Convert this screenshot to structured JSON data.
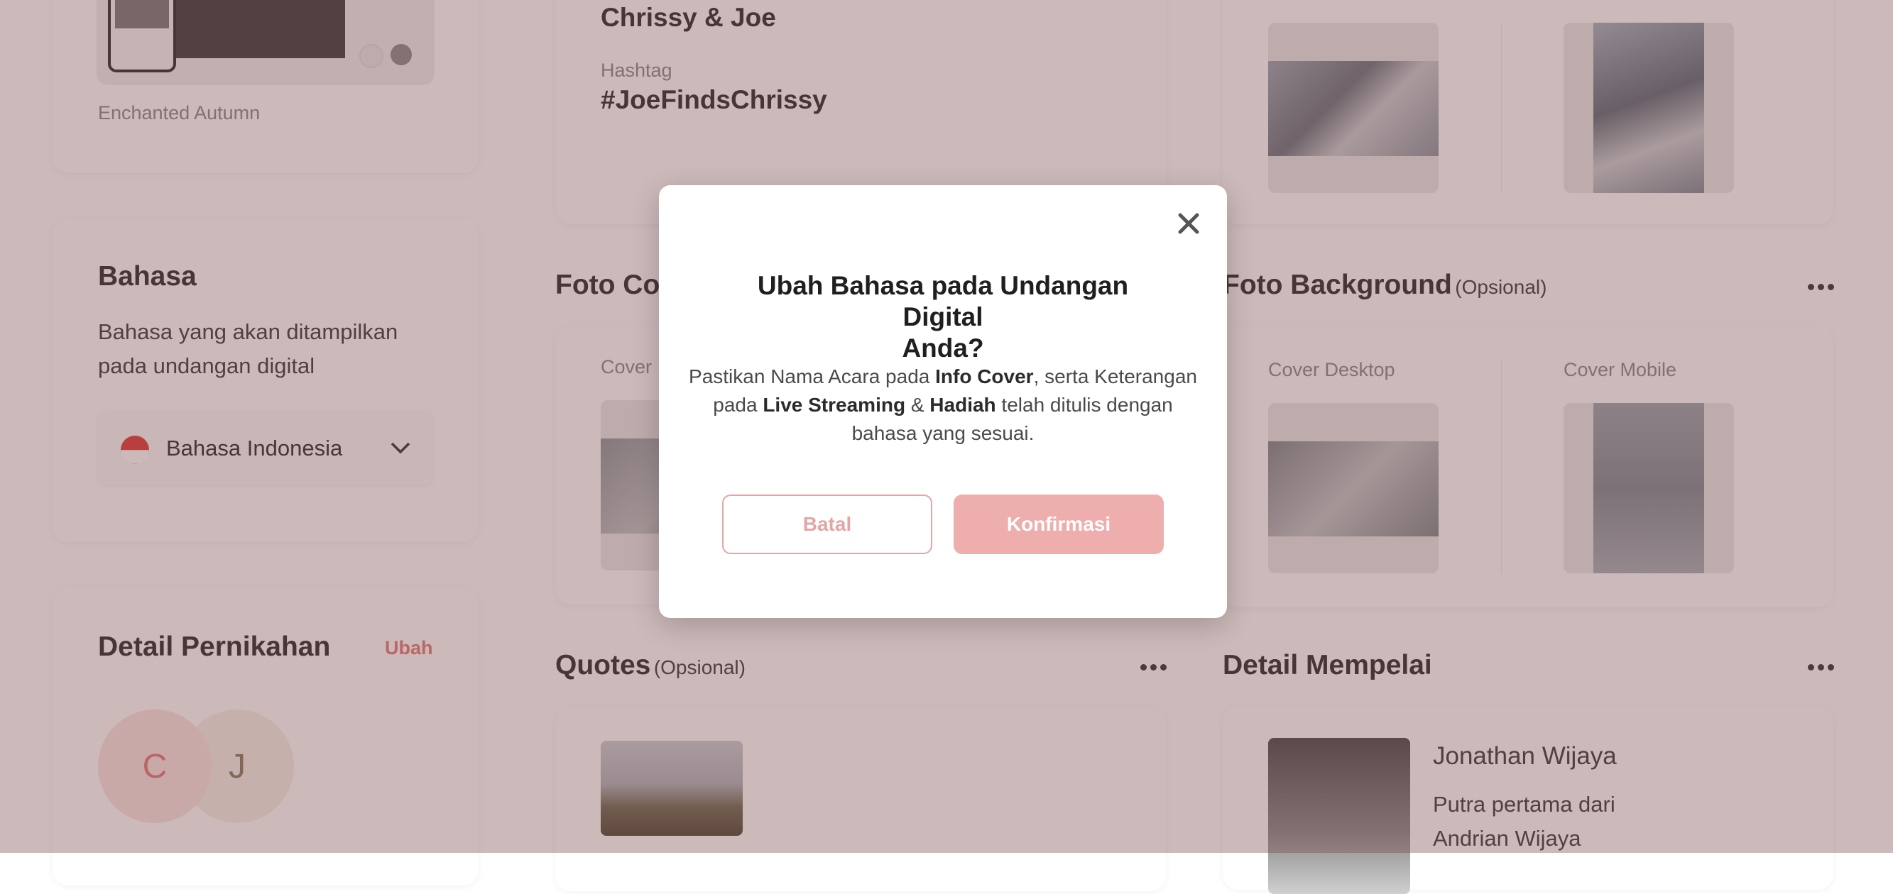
{
  "theme_card": {
    "theme_name": "Enchanted Autumn"
  },
  "language_card": {
    "title": "Bahasa",
    "description_line1": "Bahasa yang akan ditampilkan",
    "description_line2": "pada undangan digital",
    "selected_language": "Bahasa Indonesia"
  },
  "wedding_detail_card": {
    "title": "Detail Pernikahan",
    "edit_label": "Ubah",
    "avatar_initials": [
      "C",
      "J"
    ]
  },
  "info_cover": {
    "event_name": "Chrissy & Joe",
    "hashtag_label": "Hashtag",
    "hashtag_value": "#JoeFindsChrissy"
  },
  "foto_cover": {
    "title": "Foto Co",
    "cover_label": "Cover"
  },
  "foto_background": {
    "title": "Foto Background",
    "optional_label": "(Opsional)",
    "desktop_label": "Cover Desktop",
    "mobile_label": "Cover Mobile"
  },
  "quotes": {
    "title": "Quotes",
    "optional_label": "(Opsional)"
  },
  "detail_mempelai": {
    "title": "Detail Mempelai",
    "groom_name": "Jonathan Wijaya",
    "groom_desc_line1": "Putra pertama dari",
    "groom_desc_line2": "Andrian Wijaya"
  },
  "modal": {
    "title_line1": "Ubah Bahasa pada Undangan Digital",
    "title_line2": "Anda?",
    "body_1": "Pastikan Nama Acara pada ",
    "body_bold_1": "Info Cover",
    "body_2": ", serta Keterangan pada ",
    "body_bold_2": "Live Streaming",
    "body_3": " & ",
    "body_bold_3": "Hadiah",
    "body_4": " telah ditulis dengan bahasa yang sesuai.",
    "cancel_label": "Batal",
    "confirm_label": "Konfirmasi"
  },
  "colors": {
    "accent": "#eeaeae",
    "overlay": "#78464661"
  }
}
